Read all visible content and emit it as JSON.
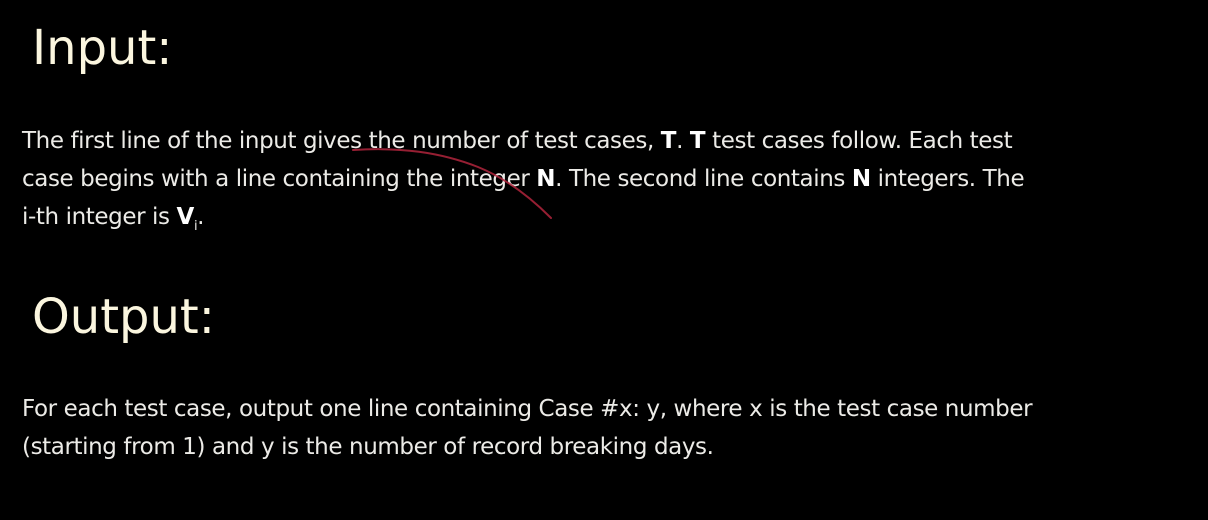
{
  "input": {
    "heading": "Input:",
    "line1_a": "The first line of the input gives the number of test cases, ",
    "line1_b1": "T",
    "line1_c": ". ",
    "line1_b2": "T",
    "line1_d": " test cases follow. Each test",
    "line2_a": "case begins with a line containing the integer ",
    "line2_b1": "N",
    "line2_c": ". The second line contains ",
    "line2_b2": "N",
    "line2_d": " integers. The",
    "line3_a": "i-th integer is ",
    "line3_b": "V",
    "line3_sub": "i",
    "line3_end": "."
  },
  "output": {
    "heading": "Output:",
    "line1": "For each test case, output one line containing Case #x: y, where x is the test case number",
    "line2": "(starting from 1) and y is the number of record breaking days."
  },
  "annotation": {
    "stroke_color": "#b0243c"
  }
}
